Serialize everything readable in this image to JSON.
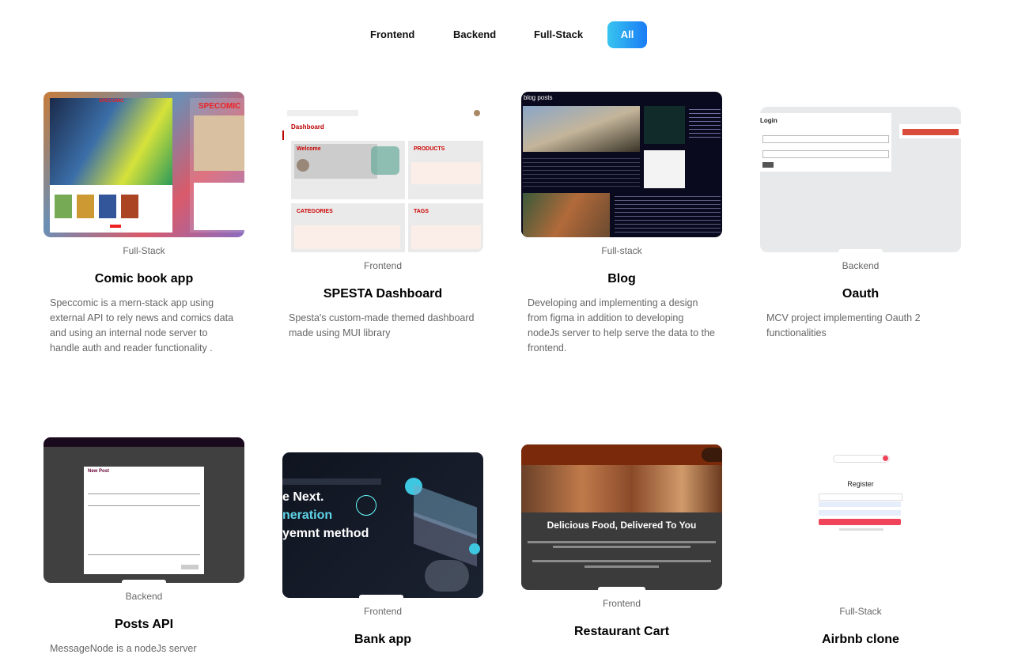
{
  "filters": [
    {
      "label": "Frontend",
      "active": false
    },
    {
      "label": "Backend",
      "active": false
    },
    {
      "label": "Full-Stack",
      "active": false
    },
    {
      "label": "All",
      "active": true
    }
  ],
  "projects": [
    {
      "category": "Full-Stack",
      "title": "Comic book app",
      "description": "Speccomic is a mern-stack app using external API to rely news and comics data and using an internal node server to handle auth and reader functionality .",
      "thumb": {
        "logo": "SPECOMIC",
        "logo2": "SPECOMIC"
      }
    },
    {
      "category": "Frontend",
      "title": "SPESTA Dashboard",
      "description": "Spesta's custom-made themed dashboard made using MUI library",
      "thumb": {
        "heading": "Dashboard",
        "welcome": "Welcome",
        "products": "PRODUCTS",
        "categories": "CATEGORIES",
        "tags": "TAGS"
      }
    },
    {
      "category": "Full-stack",
      "title": "Blog",
      "description": "Developing and implementing a design from figma in addition to developing nodeJs server to help serve the data to the frontend.",
      "thumb": {
        "heading": "blog posts"
      }
    },
    {
      "category": "Backend",
      "title": "Oauth",
      "description": "MCV project implementing Oauth 2 functionalities",
      "thumb": {
        "heading": "Login"
      }
    },
    {
      "category": "Backend",
      "title": "Posts API",
      "description": "MessageNode is a nodeJs server",
      "thumb": {
        "heading": "New Post"
      }
    },
    {
      "category": "Frontend",
      "title": "Bank app",
      "description": "",
      "thumb": {
        "line1": "e Next.",
        "line2": "neration",
        "line3": "yemnt method"
      }
    },
    {
      "category": "Frontend",
      "title": "Restaurant Cart",
      "description": "",
      "thumb": {
        "headline": "Delicious Food, Delivered To You"
      }
    },
    {
      "category": "Full-Stack",
      "title": "Airbnb clone",
      "description": "",
      "thumb": {
        "heading": "Register"
      }
    }
  ]
}
